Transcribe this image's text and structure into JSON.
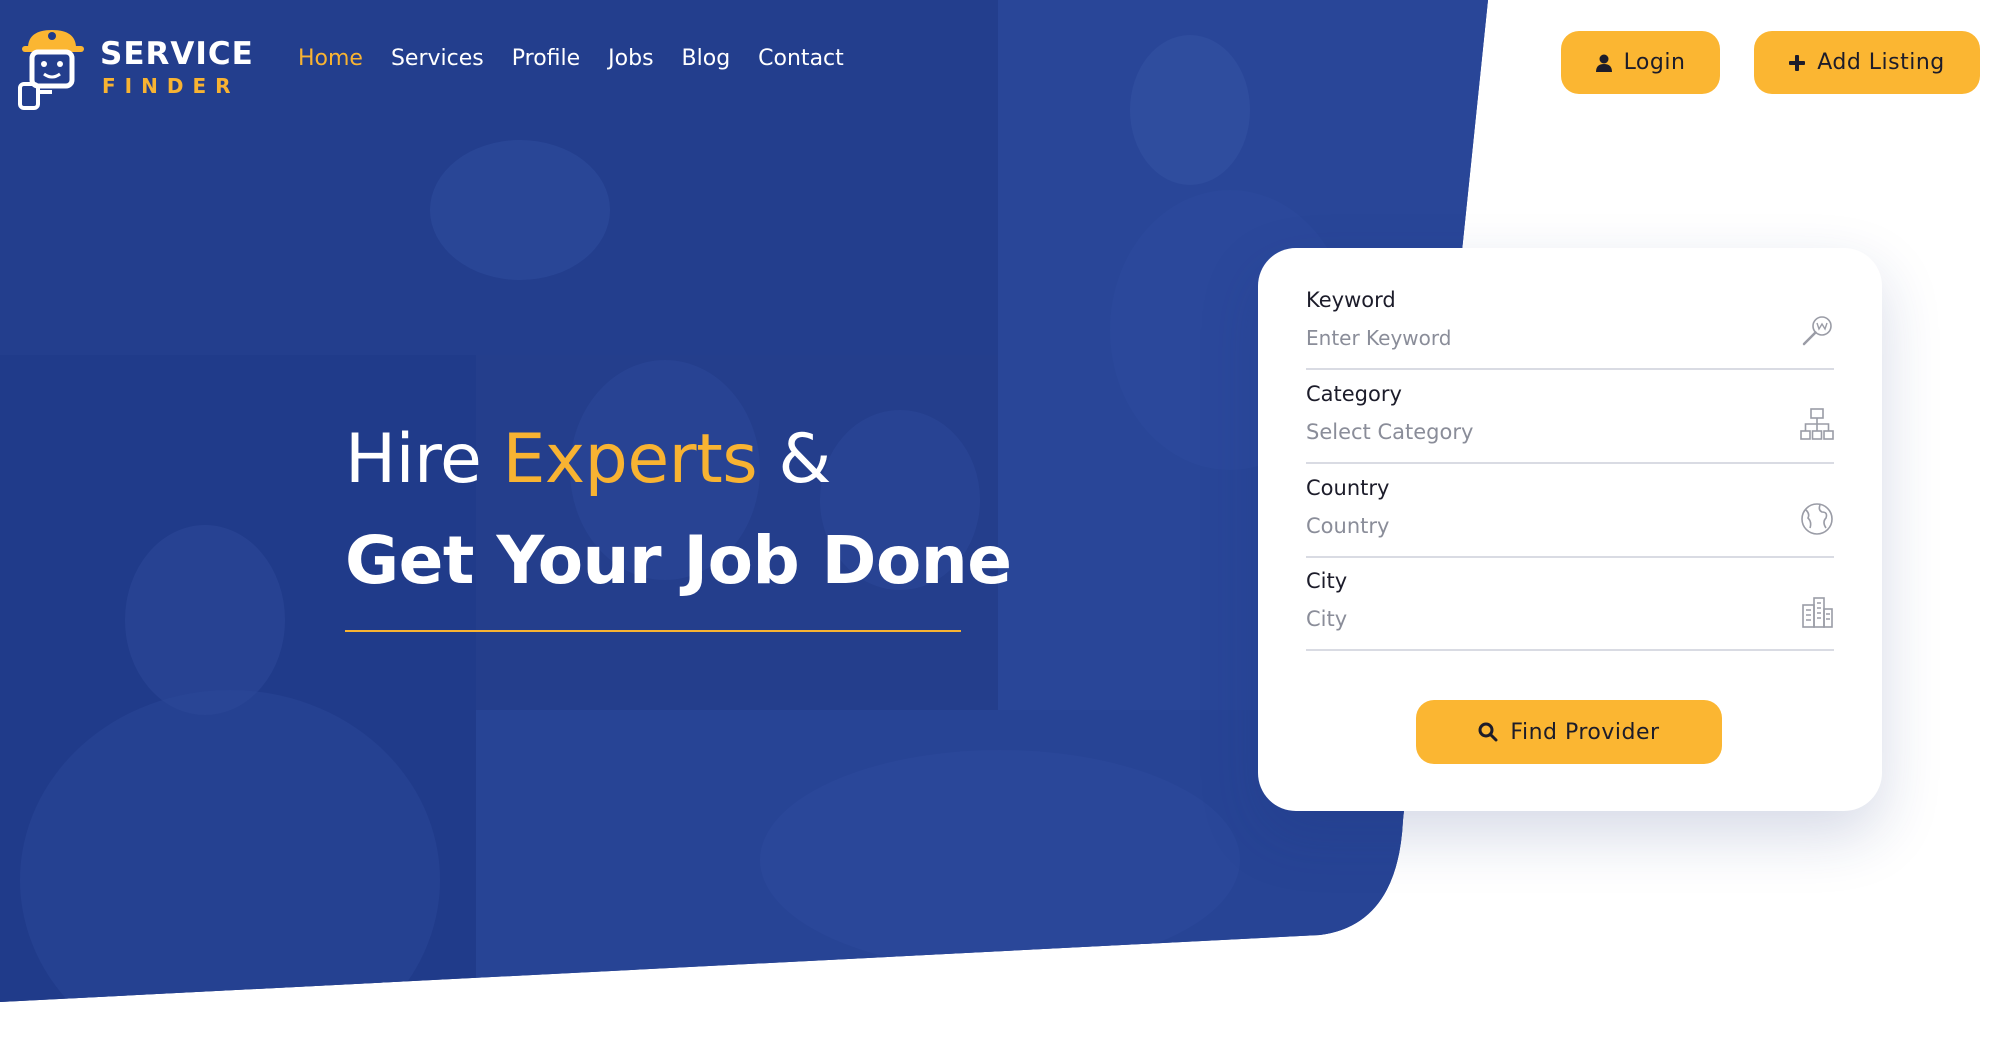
{
  "brand": {
    "name_line1": "SERVICE",
    "name_line2": "FINDER"
  },
  "nav": {
    "items": [
      {
        "label": "Home",
        "active": true
      },
      {
        "label": "Services",
        "active": false
      },
      {
        "label": "Profile",
        "active": false
      },
      {
        "label": "Jobs",
        "active": false
      },
      {
        "label": "Blog",
        "active": false
      },
      {
        "label": "Contact",
        "active": false
      }
    ]
  },
  "header": {
    "login_label": "Login",
    "login_icon": "user-icon",
    "add_listing_label": "Add Listing",
    "add_listing_icon": "plus-icon"
  },
  "hero": {
    "headline_part1": "Hire ",
    "headline_accent": "Experts",
    "headline_part2": " &",
    "headline_bold": "Get Your Job Done"
  },
  "search": {
    "keyword": {
      "label": "Keyword",
      "placeholder": "Enter Keyword",
      "icon": "keyword-search-icon"
    },
    "category": {
      "label": "Category",
      "placeholder": "Select Category",
      "icon": "category-tree-icon"
    },
    "country": {
      "label": "Country",
      "placeholder": "Country",
      "icon": "globe-icon"
    },
    "city": {
      "label": "City",
      "placeholder": "City",
      "icon": "city-buildings-icon"
    },
    "submit_label": "Find Provider",
    "submit_icon": "search-icon"
  },
  "colors": {
    "primary_blue": "#1e3a8a",
    "accent_yellow": "#fbb632",
    "text_dark": "#1c1c2a",
    "placeholder_gray": "#8a8d99"
  }
}
